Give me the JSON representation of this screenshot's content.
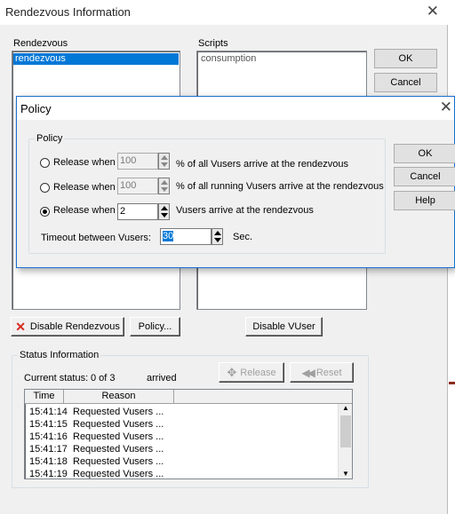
{
  "main_dialog": {
    "title": "Rendezvous Information",
    "rendezvous_label": "Rendezvous",
    "rendezvous_items": [
      "rendezvous"
    ],
    "scripts_label": "Scripts",
    "scripts_items": [
      "consumption"
    ],
    "ok_label": "OK",
    "cancel_label": "Cancel",
    "disable_rendezvous_label": "Disable Rendezvous",
    "policy_button_label": "Policy...",
    "disable_vuser_label": "Disable VUser",
    "status": {
      "group_title": "Status Information",
      "current_status_label": "Current status:",
      "current_status_value": "0 of 3",
      "arrived_label": "arrived",
      "release_label": "Release",
      "reset_label": "Reset",
      "columns": [
        "Time",
        "Reason"
      ],
      "rows": [
        {
          "time": "15:41:14",
          "reason": "Requested Vusers ..."
        },
        {
          "time": "15:41:15",
          "reason": "Requested Vusers ..."
        },
        {
          "time": "15:41:16",
          "reason": "Requested Vusers ..."
        },
        {
          "time": "15:41:17",
          "reason": "Requested Vusers ..."
        },
        {
          "time": "15:41:18",
          "reason": "Requested Vusers ..."
        },
        {
          "time": "15:41:19",
          "reason": "Requested Vusers ..."
        }
      ]
    }
  },
  "policy_dialog": {
    "title": "Policy",
    "group_title": "Policy",
    "options": [
      {
        "label": "Release when",
        "value": "100",
        "suffix": "% of all Vusers arrive at the rendezvous",
        "selected": false
      },
      {
        "label": "Release when",
        "value": "100",
        "suffix": "% of all running Vusers arrive at the rendezvous",
        "selected": false
      },
      {
        "label": "Release when",
        "value": "2",
        "suffix": "Vusers arrive at the rendezvous",
        "selected": true
      }
    ],
    "timeout_label": "Timeout between Vusers:",
    "timeout_value": "30",
    "timeout_unit": "Sec.",
    "ok_label": "OK",
    "cancel_label": "Cancel",
    "help_label": "Help"
  },
  "colors": {
    "selection": "#0078d7",
    "window_bg": "#f0f0f0",
    "accent_border": "#1a6fd0",
    "close_red": "#d7281e"
  },
  "icons": {
    "close": "close-icon",
    "disable": "red-x-icon",
    "release": "release-icon",
    "reset": "rewind-icon"
  }
}
